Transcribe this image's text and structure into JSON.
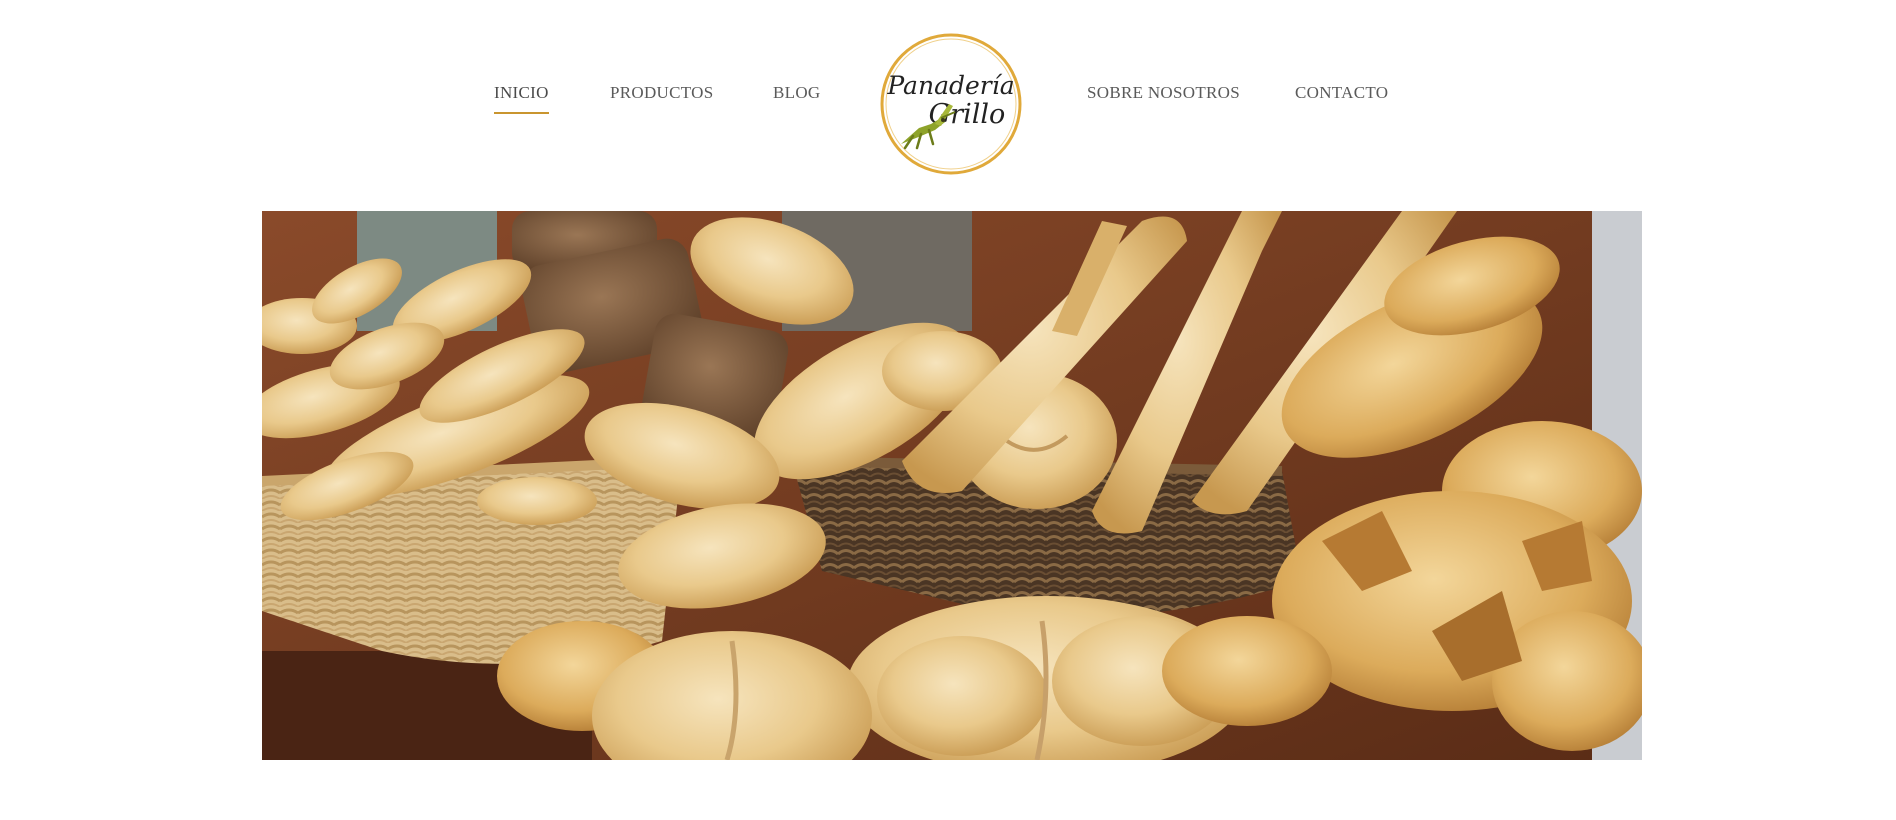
{
  "nav": {
    "left_items": [
      {
        "label": "INICIO",
        "active": true
      },
      {
        "label": "PRODUCTOS",
        "active": false
      },
      {
        "label": "BLOG",
        "active": false
      }
    ],
    "right_items": [
      {
        "label": "SOBRE NOSOTROS",
        "active": false
      },
      {
        "label": "CONTACTO",
        "active": false
      }
    ],
    "active_underline_color": "#c9952f"
  },
  "logo": {
    "line1": "Panadería",
    "line2": "Grillo",
    "ring_color": "#e0a93a",
    "icon": "grasshopper-icon"
  },
  "hero": {
    "image": "bread-baskets-photo"
  }
}
